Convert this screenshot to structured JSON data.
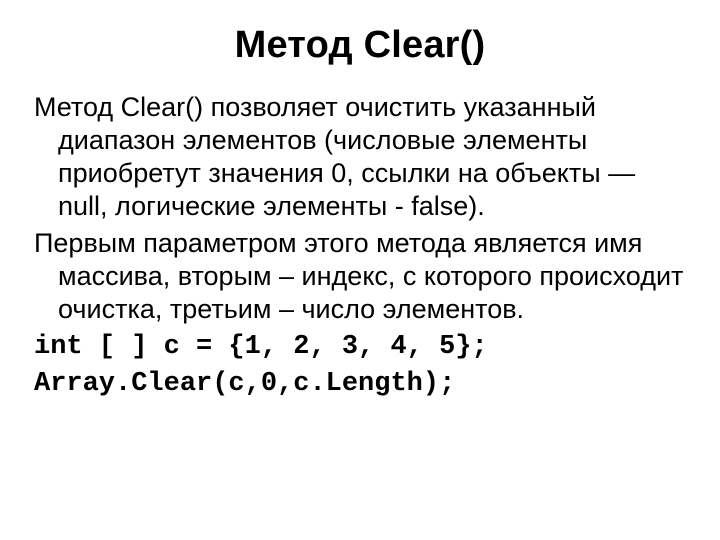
{
  "slide": {
    "title": "Метод Clear()",
    "paragraph1": "Метод Clear() позволяет очистить указанный диапазон элементов (числовые элементы приобретут значения 0, ссылки на объекты — null, логические элементы - false).",
    "paragraph2": "Первым параметром этого метода является имя массива, вторым – индекс, с которого происходит очистка, третьим – число элементов.",
    "code_line1": "int [ ] c = {1, 2, 3, 4, 5};",
    "code_line2": "Array.Clear(c,0,c.Length);"
  }
}
